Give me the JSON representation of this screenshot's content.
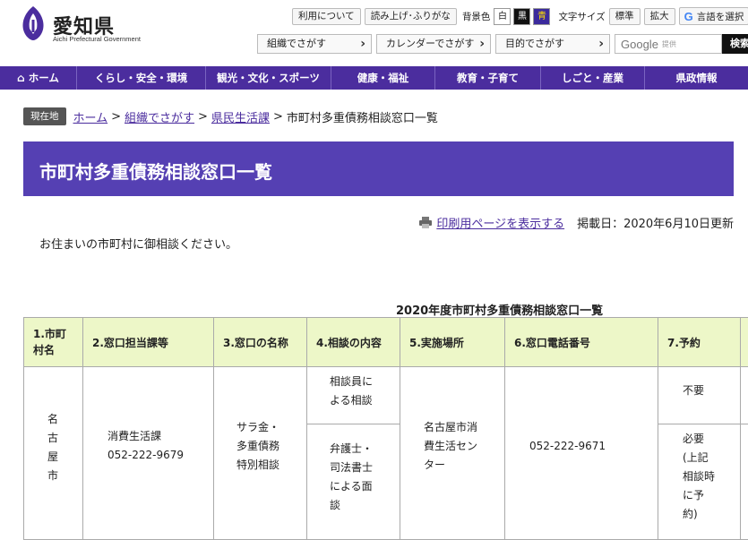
{
  "header": {
    "logo_main": "愛知県",
    "logo_sub": "Aichi Prefectural Government",
    "util": {
      "about": "利用について",
      "read_aloud": "読み上げ･ふりがな",
      "bg_label": "背景色",
      "bg_white": "白",
      "bg_black": "黒",
      "bg_blue": "青",
      "text_size_label": "文字サイズ",
      "standard": "標準",
      "enlarge": "拡大",
      "language": "言語を選択"
    },
    "search": {
      "by_org": "組織でさがす",
      "by_calendar": "カレンダーでさがす",
      "by_purpose": "目的でさがす",
      "google_word": "Google",
      "google_small": "提供",
      "search_button": "検索"
    }
  },
  "nav": {
    "items": [
      "ホーム",
      "くらし・安全・環境",
      "観光・文化・スポーツ",
      "健康・福祉",
      "教育・子育て",
      "しごと・産業",
      "県政情報"
    ]
  },
  "breadcrumb": {
    "here": "現在地",
    "home": "ホーム",
    "org": "組織でさがす",
    "dept": "県民生活課",
    "current": "市町村多重債務相談窓口一覧",
    "sep": ">"
  },
  "page": {
    "title": "市町村多重債務相談窓口一覧",
    "print_link": "印刷用ページを表示する",
    "updated": "掲載日：2020年6月10日更新",
    "intro": "お住まいの市町村に御相談ください。",
    "table_caption": "2020年度市町村多重債務相談窓口一覧"
  },
  "table": {
    "headers": [
      "1.市町\n村名",
      "2.窓口担当課等",
      "3.窓口の名称",
      "4.相談の内容",
      "5.実施場所",
      "6.窓口電話番号",
      "7.予約"
    ],
    "row1": {
      "city": "名\n古\n屋\n市",
      "dept": "消費生活課\n052-222-9679",
      "name": "サラ金・\n多重債務\n特別相談",
      "content_a": "相談員に\nよる相談",
      "content_b": "弁護士・\n司法書士\nによる面\n談",
      "place": "名古屋市消\n費生活セン\nター",
      "phone": "052-222-9671",
      "reserve_a": "不要",
      "reserve_b": "必要\n(上記\n相談時\nに予\n約)"
    }
  },
  "colors": {
    "nav_bg": "#4b2d9e",
    "title_bg": "#5540b3",
    "header_cell_bg": "#edf7c8",
    "link": "#4b2d9e"
  }
}
